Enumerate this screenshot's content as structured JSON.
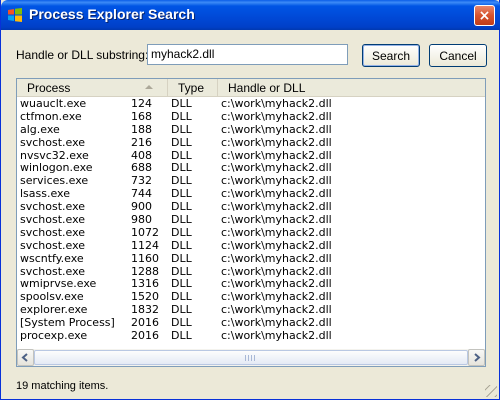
{
  "window": {
    "title": "Process Explorer Search",
    "icon": "windows-flag-icon",
    "close_label": "×"
  },
  "search": {
    "label": "Handle or DLL substring:",
    "value": "myhack2.dll",
    "search_button": "Search",
    "cancel_button": "Cancel"
  },
  "table": {
    "columns": [
      "Process",
      "Type",
      "Handle or DLL"
    ],
    "sort_icon": "sort-ascending-icon",
    "rows": [
      {
        "process": "wuauclt.exe",
        "pid": "124",
        "type": "DLL",
        "handle": "c:\\work\\myhack2.dll"
      },
      {
        "process": "ctfmon.exe",
        "pid": "168",
        "type": "DLL",
        "handle": "c:\\work\\myhack2.dll"
      },
      {
        "process": "alg.exe",
        "pid": "188",
        "type": "DLL",
        "handle": "c:\\work\\myhack2.dll"
      },
      {
        "process": "svchost.exe",
        "pid": "216",
        "type": "DLL",
        "handle": "c:\\work\\myhack2.dll"
      },
      {
        "process": "nvsvc32.exe",
        "pid": "408",
        "type": "DLL",
        "handle": "c:\\work\\myhack2.dll"
      },
      {
        "process": "winlogon.exe",
        "pid": "688",
        "type": "DLL",
        "handle": "c:\\work\\myhack2.dll"
      },
      {
        "process": "services.exe",
        "pid": "732",
        "type": "DLL",
        "handle": "c:\\work\\myhack2.dll"
      },
      {
        "process": "lsass.exe",
        "pid": "744",
        "type": "DLL",
        "handle": "c:\\work\\myhack2.dll"
      },
      {
        "process": "svchost.exe",
        "pid": "900",
        "type": "DLL",
        "handle": "c:\\work\\myhack2.dll"
      },
      {
        "process": "svchost.exe",
        "pid": "980",
        "type": "DLL",
        "handle": "c:\\work\\myhack2.dll"
      },
      {
        "process": "svchost.exe",
        "pid": "1072",
        "type": "DLL",
        "handle": "c:\\work\\myhack2.dll"
      },
      {
        "process": "svchost.exe",
        "pid": "1124",
        "type": "DLL",
        "handle": "c:\\work\\myhack2.dll"
      },
      {
        "process": "wscntfy.exe",
        "pid": "1160",
        "type": "DLL",
        "handle": "c:\\work\\myhack2.dll"
      },
      {
        "process": "svchost.exe",
        "pid": "1288",
        "type": "DLL",
        "handle": "c:\\work\\myhack2.dll"
      },
      {
        "process": "wmiprvse.exe",
        "pid": "1316",
        "type": "DLL",
        "handle": "c:\\work\\myhack2.dll"
      },
      {
        "process": "spoolsv.exe",
        "pid": "1520",
        "type": "DLL",
        "handle": "c:\\work\\myhack2.dll"
      },
      {
        "process": "explorer.exe",
        "pid": "1832",
        "type": "DLL",
        "handle": "c:\\work\\myhack2.dll"
      },
      {
        "process": "[System Process]",
        "pid": "2016",
        "type": "DLL",
        "handle": "c:\\work\\myhack2.dll"
      },
      {
        "process": "procexp.exe",
        "pid": "2016",
        "type": "DLL",
        "handle": "c:\\work\\myhack2.dll"
      }
    ]
  },
  "status": {
    "text": "19 matching items."
  },
  "colors": {
    "titlebar": "#0055e5",
    "window_bg": "#ece9d8",
    "list_border": "#7f9db9"
  }
}
